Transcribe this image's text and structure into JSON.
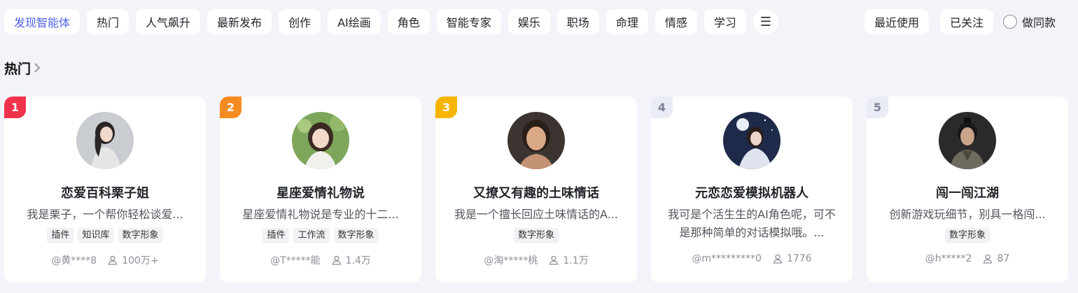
{
  "tabs": [
    {
      "label": "发现智能体",
      "active": true
    },
    {
      "label": "热门"
    },
    {
      "label": "人气飙升"
    },
    {
      "label": "最新发布"
    },
    {
      "label": "创作"
    },
    {
      "label": "AI绘画"
    },
    {
      "label": "角色"
    },
    {
      "label": "智能专家"
    },
    {
      "label": "娱乐"
    },
    {
      "label": "职场"
    },
    {
      "label": "命理"
    },
    {
      "label": "情感"
    },
    {
      "label": "学习"
    }
  ],
  "more_icon": "☰",
  "right_tabs": {
    "recent": "最近使用",
    "following": "已关注",
    "same": "做同款"
  },
  "section": {
    "title": "热门"
  },
  "colors": {
    "accent": "#4e5fe6",
    "rank1": "#f0324b",
    "rank2": "#f58a1f",
    "rank3": "#f7b500",
    "rank_other": "#e9ecf5"
  },
  "cards": [
    {
      "rank": "1",
      "title": "恋爱百科栗子姐",
      "desc": "我是栗子，一个帮你轻松谈爱...",
      "tags": [
        "插件",
        "知识库",
        "数字形象"
      ],
      "author": "@黄****8",
      "users": "100万+"
    },
    {
      "rank": "2",
      "title": "星座爱情礼物说",
      "desc": "星座爱情礼物说是专业的十二...",
      "tags": [
        "插件",
        "工作流",
        "数字形象"
      ],
      "author": "@T*****能",
      "users": "1.4万"
    },
    {
      "rank": "3",
      "title": "又撩又有趣的土味情话",
      "desc": "我是一个擅长回应土味情话的A...",
      "tags": [
        "数字形象"
      ],
      "author": "@淘*****桃",
      "users": "1.1万"
    },
    {
      "rank": "4",
      "title": "元恋恋爱模拟机器人",
      "desc": "我可是个活生生的AI角色呢，可不是那种简单的对话模拟哦。...",
      "tags": [
        "数字形象"
      ],
      "author": "@m*********0",
      "users": "1776"
    },
    {
      "rank": "5",
      "title": "闯一闯江湖",
      "desc": "创新游戏玩细节，别具一格闯...",
      "tags": [
        "数字形象"
      ],
      "author": "@h*****2",
      "users": "87"
    }
  ]
}
